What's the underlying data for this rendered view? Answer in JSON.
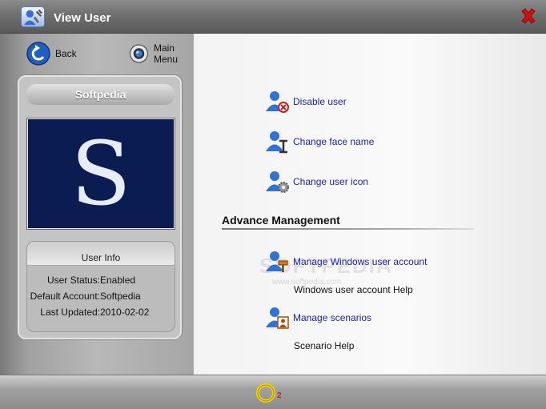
{
  "window": {
    "title": "View User"
  },
  "nav": {
    "back_label": "Back",
    "main_menu_label": "Main Menu"
  },
  "user": {
    "name": "Softpedia",
    "avatar_letter": "S"
  },
  "info": {
    "heading": "User Info",
    "rows": [
      {
        "label": "User Status:",
        "value": "Enabled"
      },
      {
        "label": "Default Account:",
        "value": "Softpedia"
      },
      {
        "label": "Last Updated:",
        "value": "2010-02-02"
      }
    ]
  },
  "actions": {
    "disable_user": "Disable user",
    "change_face_name": "Change face name",
    "change_user_icon": "Change user icon"
  },
  "advance": {
    "title": "Advance Management",
    "manage_windows_account": "Manage Windows user account",
    "windows_account_help": "Windows user account Help",
    "manage_scenarios": "Manage scenarios",
    "scenario_help": "Scenario Help"
  },
  "watermark": {
    "main": "SOFTPEDIA",
    "sub": "www.softpedia.com"
  },
  "footer": {
    "logo_mark": "2"
  },
  "colors": {
    "link": "#1c22b8",
    "avatar_bg": "#0b1c52",
    "close_red": "#d01010",
    "logo_yellow": "#f2d400"
  }
}
